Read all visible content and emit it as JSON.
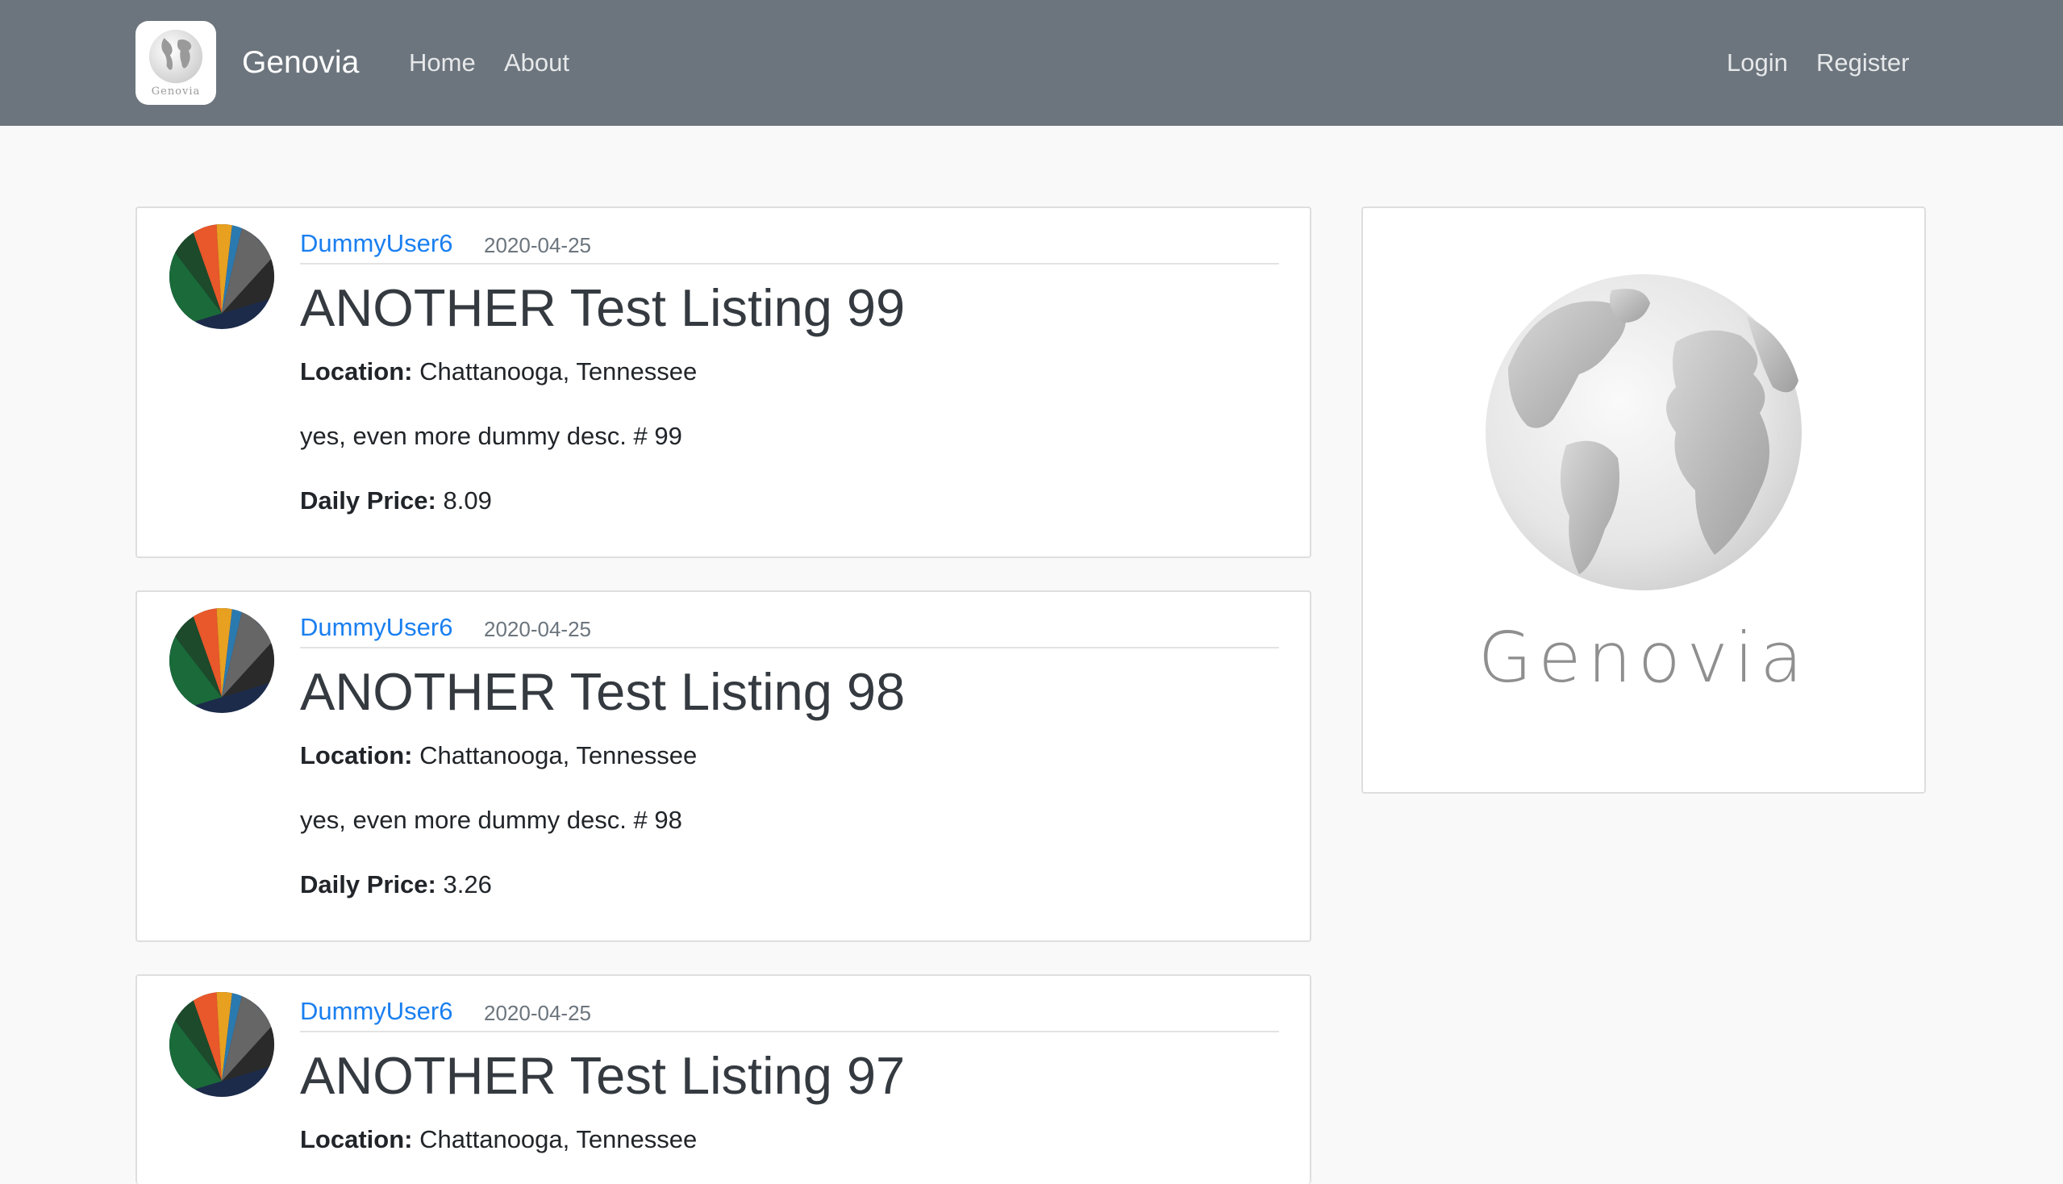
{
  "navbar": {
    "logo_text": "Genovia",
    "brand": "Genovia",
    "links": {
      "home": "Home",
      "about": "About",
      "login": "Login",
      "register": "Register"
    }
  },
  "listings": [
    {
      "author": "DummyUser6",
      "date": "2020-04-25",
      "title": "ANOTHER Test Listing 99",
      "location_label": "Location:",
      "location": " Chattanooga, Tennessee",
      "description": "yes, even more dummy desc. # 99",
      "price_label": "Daily Price:",
      "price": " 8.09"
    },
    {
      "author": "DummyUser6",
      "date": "2020-04-25",
      "title": "ANOTHER Test Listing 98",
      "location_label": "Location:",
      "location": " Chattanooga, Tennessee",
      "description": "yes, even more dummy desc. # 98",
      "price_label": "Daily Price:",
      "price": " 3.26"
    },
    {
      "author": "DummyUser6",
      "date": "2020-04-25",
      "title": "ANOTHER Test Listing 97",
      "location_label": "Location:",
      "location": " Chattanooga, Tennessee"
    }
  ],
  "sidebar": {
    "logo_text": "Genovia"
  },
  "colors": {
    "navbar_bg": "#6c757d",
    "page_bg": "#f9f9f9",
    "link": "#1a7ff0",
    "muted": "#6c757d"
  }
}
